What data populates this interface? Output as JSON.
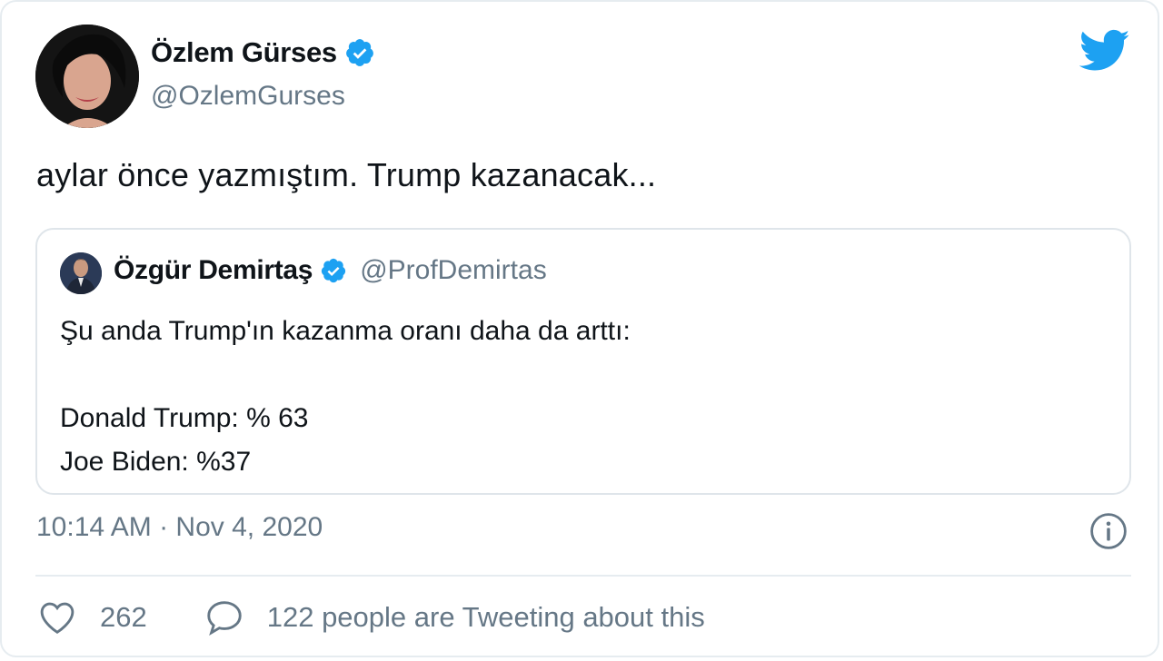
{
  "author": {
    "name": "Özlem Gürses",
    "handle": "@OzlemGurses",
    "verified": true
  },
  "tweet": {
    "text": "aylar önce yazmıştım. Trump kazanacak..."
  },
  "quoted_tweet": {
    "name": "Özgür Demirtaş",
    "handle": "@ProfDemirtas",
    "verified": true,
    "body": "Şu anda Trump'ın kazanma oranı daha da arttı:\n\nDonald Trump: % 63\nJoe Biden: %37"
  },
  "timestamp": "10:14 AM · Nov 4, 2020",
  "engagement": {
    "likes": "262",
    "tweeting_text": "122 people are Tweeting about this"
  },
  "icons": {
    "brand": "twitter-bird-icon",
    "verified": "verified-badge-icon",
    "info": "info-icon",
    "like": "heart-icon",
    "reply": "speech-bubble-icon"
  },
  "colors": {
    "accent": "#1da1f2",
    "muted_text": "#657786",
    "border": "#e6ecf0"
  }
}
